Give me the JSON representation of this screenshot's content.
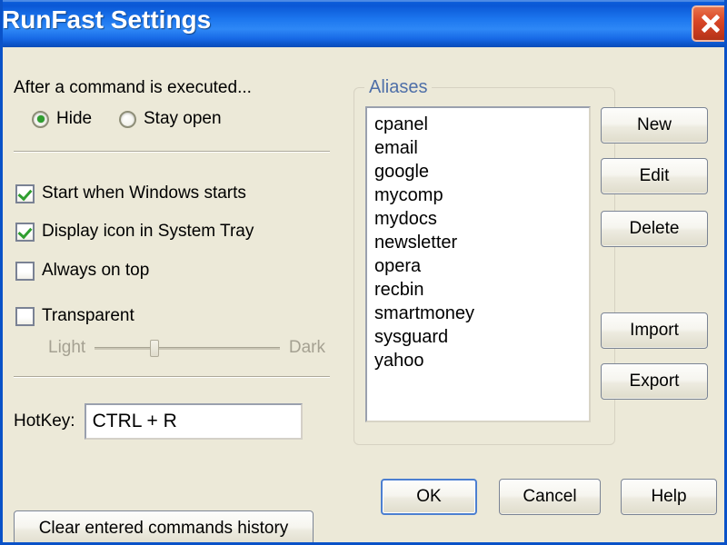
{
  "window": {
    "title": "RunFast Settings",
    "close_icon": "close-icon",
    "background_color": "#ECE9D8",
    "titlebar_color": "#0A52C8",
    "close_button_color": "#D94828"
  },
  "left_panel": {
    "execution_label": "After a command is executed...",
    "radios": [
      {
        "label": "Hide",
        "selected": true
      },
      {
        "label": "Stay open",
        "selected": false
      }
    ],
    "checkboxes": [
      {
        "label": "Start when Windows starts",
        "checked": true
      },
      {
        "label": "Display icon in System Tray",
        "checked": true
      },
      {
        "label": "Always on top",
        "checked": false
      },
      {
        "label": "Transparent",
        "checked": false
      }
    ],
    "slider": {
      "min_label": "Light",
      "max_label": "Dark",
      "value_percent": 30,
      "enabled": false
    },
    "hotkey": {
      "label": "HotKey:",
      "value": "CTRL + R"
    },
    "clear_history_label": "Clear entered commands history"
  },
  "aliases": {
    "legend": "Aliases",
    "legend_color": "#4E6FA8",
    "items": [
      "cpanel",
      "email",
      "google",
      "mycomp",
      "mydocs",
      "newsletter",
      "opera",
      "recbin",
      "smartmoney",
      "sysguard",
      "yahoo"
    ],
    "buttons": {
      "new": "New",
      "edit": "Edit",
      "delete": "Delete",
      "import": "Import",
      "export": "Export"
    }
  },
  "dialog_buttons": {
    "ok": "OK",
    "cancel": "Cancel",
    "help": "Help",
    "default": "OK"
  }
}
